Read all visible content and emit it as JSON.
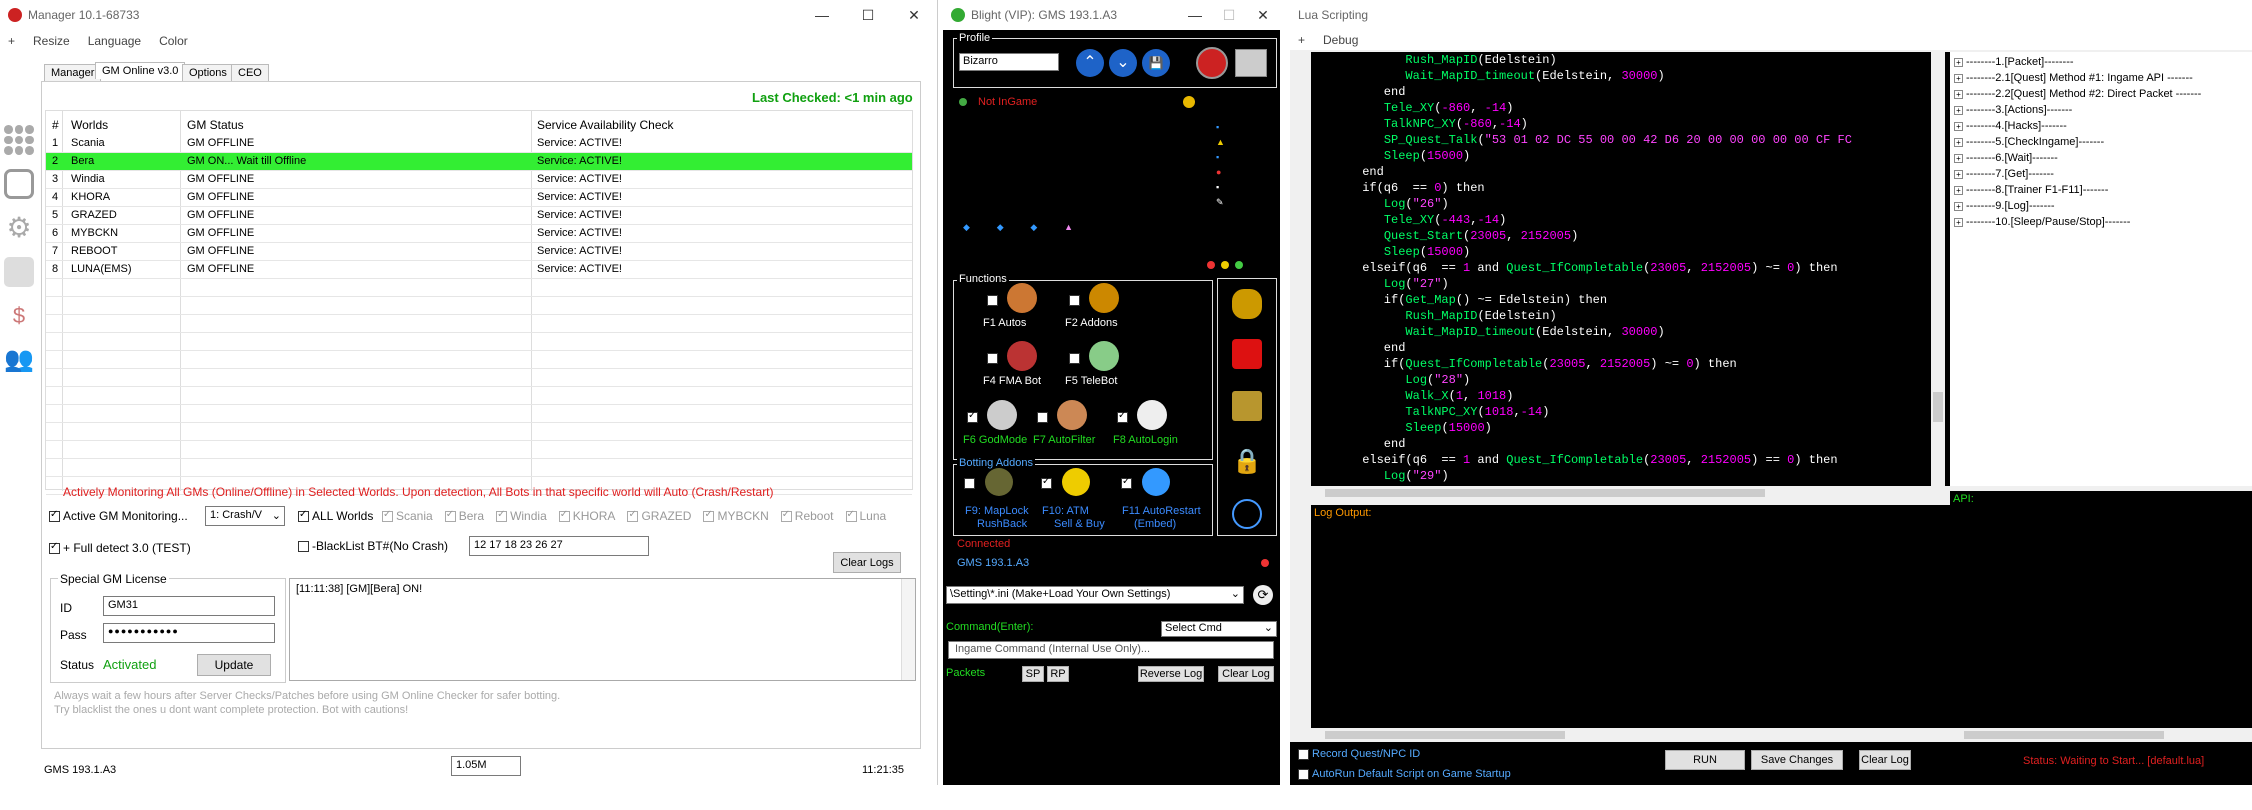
{
  "manager": {
    "title": "Manager 10.1-68733",
    "menu": [
      "+",
      "Resize",
      "Language",
      "Color"
    ],
    "tabs": [
      "Manager",
      "GM Online v3.0",
      "Options",
      "CEO"
    ],
    "last_checked": "Last Checked: <1 min ago",
    "table": {
      "headers": [
        "#",
        "Worlds",
        "GM Status",
        "Service Availability Check"
      ],
      "rows": [
        [
          "1",
          "Scania",
          "GM OFFLINE",
          "Service: ACTIVE!"
        ],
        [
          "2",
          "Bera",
          "GM ON... Wait till Offline",
          "Service: ACTIVE!"
        ],
        [
          "3",
          "Windia",
          "GM OFFLINE",
          "Service: ACTIVE!"
        ],
        [
          "4",
          "KHORA",
          "GM OFFLINE",
          "Service: ACTIVE!"
        ],
        [
          "5",
          "GRAZED",
          "GM OFFLINE",
          "Service: ACTIVE!"
        ],
        [
          "6",
          "MYBCKN",
          "GM OFFLINE",
          "Service: ACTIVE!"
        ],
        [
          "7",
          "REBOOT",
          "GM OFFLINE",
          "Service: ACTIVE!"
        ],
        [
          "8",
          "LUNA(EMS)",
          "GM OFFLINE",
          "Service: ACTIVE!"
        ]
      ]
    },
    "monitor_notice": "Actively Monitoring All GMs (Online/Offline) in Selected Worlds. Upon detection, All Bots in that specific world will Auto (Crash/Restart)",
    "active_gm_monitoring": "Active GM Monitoring...",
    "crash_select": "1: Crash/V",
    "all_worlds": "ALL Worlds",
    "worlds_checks": [
      "Scania",
      "Bera",
      "Windia",
      "KHORA",
      "GRAZED",
      "MYBCKN",
      "Reboot",
      "Luna"
    ],
    "full_detect": "+ Full detect 3.0 (TEST)",
    "blacklist_label": "-BlackList BT#(No Crash)",
    "blacklist_value": "12 17 18 23 26 27",
    "clear_logs": "Clear Logs",
    "license_title": "Special GM License",
    "id_label": "ID",
    "id_value": "GM31",
    "pass_label": "Pass",
    "pass_value": "●●●●●●●●●●●",
    "status_label": "Status",
    "status_value": "Activated",
    "update_btn": "Update",
    "log_text": "[11:11:38] [GM][Bera] ON!",
    "footer_note_1": "Always wait a few hours after Server Checks/Patches before using GM Online Checker for safer botting.",
    "footer_note_2": "Try blacklist the ones u dont want complete protection. Bot with cautions!",
    "status_bar_left": "GMS 193.1.A3",
    "status_bar_mid": "1.05M",
    "status_bar_time": "11:21:35"
  },
  "blight": {
    "title": "Blight (VIP): GMS 193.1.A3",
    "profile_label": "Profile",
    "profile_value": "Bizarro",
    "not_ingame": "Not InGame",
    "functions_label": "Functions",
    "functions": [
      {
        "key": "F1",
        "name": "Autos"
      },
      {
        "key": "F2",
        "name": "Addons"
      },
      {
        "key": "F4",
        "name": "FMA Bot"
      },
      {
        "key": "F5",
        "name": "TeleBot"
      },
      {
        "key": "F6",
        "name": "GodMode"
      },
      {
        "key": "F7",
        "name": "AutoFilter"
      },
      {
        "key": "F8",
        "name": "AutoLogin"
      }
    ],
    "botting_label": "Botting Addons",
    "botting": [
      {
        "line1": "F9: MapLock",
        "line2": "RushBack"
      },
      {
        "line1": "F10: ATM",
        "line2": "Sell & Buy"
      },
      {
        "line1": "F11 AutoRestart",
        "line2": "(Embed)"
      }
    ],
    "connected": "Connected",
    "version": "GMS 193.1.A3",
    "settings_select": "\\Setting\\*.ini (Make+Load Your Own Settings)",
    "command_label": "Command(Enter):",
    "select_cmd": "Select Cmd",
    "ingame_cmd_placeholder": "Ingame Command (Internal Use Only)...",
    "packets_label": "Packets",
    "sp": "SP",
    "rp": "RP",
    "reverse_log": "Reverse Log",
    "clear_log": "Clear Log"
  },
  "lua": {
    "title": "Lua Scripting",
    "menu": [
      "+",
      "Debug"
    ],
    "code_lines": [
      [
        {
          "t": "            ",
          "c": "txt"
        },
        {
          "t": "Rush_MapID",
          "c": "fn"
        },
        {
          "t": "(Edelstein)",
          "c": "kw"
        }
      ],
      [
        {
          "t": "            ",
          "c": "txt"
        },
        {
          "t": "Wait_MapID_timeout",
          "c": "fn"
        },
        {
          "t": "(Edelstein, ",
          "c": "kw"
        },
        {
          "t": "30000",
          "c": "num"
        },
        {
          "t": ")",
          "c": "kw"
        }
      ],
      [
        {
          "t": "         end",
          "c": "kw"
        }
      ],
      [
        {
          "t": "         ",
          "c": "txt"
        },
        {
          "t": "Tele_XY",
          "c": "fn"
        },
        {
          "t": "(",
          "c": "kw"
        },
        {
          "t": "-860",
          "c": "num"
        },
        {
          "t": ", ",
          "c": "kw"
        },
        {
          "t": "-14",
          "c": "num"
        },
        {
          "t": ")",
          "c": "kw"
        }
      ],
      [
        {
          "t": "         ",
          "c": "txt"
        },
        {
          "t": "TalkNPC_XY",
          "c": "fn"
        },
        {
          "t": "(",
          "c": "kw"
        },
        {
          "t": "-860",
          "c": "num"
        },
        {
          "t": ",",
          "c": "kw"
        },
        {
          "t": "-14",
          "c": "num"
        },
        {
          "t": ")",
          "c": "kw"
        }
      ],
      [
        {
          "t": "         ",
          "c": "txt"
        },
        {
          "t": "SP_Quest_Talk",
          "c": "fn"
        },
        {
          "t": "(",
          "c": "kw"
        },
        {
          "t": "\"53 01 02 DC 55 00 00 42 D6 20 00 00 00 00 00 CF FC",
          "c": "str"
        }
      ],
      [
        {
          "t": "         ",
          "c": "txt"
        },
        {
          "t": "Sleep",
          "c": "fn"
        },
        {
          "t": "(",
          "c": "kw"
        },
        {
          "t": "15000",
          "c": "num"
        },
        {
          "t": ")",
          "c": "kw"
        }
      ],
      [
        {
          "t": "      end",
          "c": "kw"
        }
      ],
      [
        {
          "t": "      if",
          "c": "kw"
        },
        {
          "t": "(q6  == ",
          "c": "kw"
        },
        {
          "t": "0",
          "c": "num"
        },
        {
          "t": ") then",
          "c": "kw"
        }
      ],
      [
        {
          "t": "         ",
          "c": "txt"
        },
        {
          "t": "Log",
          "c": "fn"
        },
        {
          "t": "(",
          "c": "kw"
        },
        {
          "t": "\"26\"",
          "c": "str"
        },
        {
          "t": ")",
          "c": "kw"
        }
      ],
      [
        {
          "t": "         ",
          "c": "txt"
        },
        {
          "t": "Tele_XY",
          "c": "fn"
        },
        {
          "t": "(",
          "c": "kw"
        },
        {
          "t": "-443",
          "c": "num"
        },
        {
          "t": ",",
          "c": "kw"
        },
        {
          "t": "-14",
          "c": "num"
        },
        {
          "t": ")",
          "c": "kw"
        }
      ],
      [
        {
          "t": "         ",
          "c": "txt"
        },
        {
          "t": "Quest_Start",
          "c": "fn"
        },
        {
          "t": "(",
          "c": "kw"
        },
        {
          "t": "23005",
          "c": "num"
        },
        {
          "t": ", ",
          "c": "kw"
        },
        {
          "t": "2152005",
          "c": "num"
        },
        {
          "t": ")",
          "c": "kw"
        }
      ],
      [
        {
          "t": "         ",
          "c": "txt"
        },
        {
          "t": "Sleep",
          "c": "fn"
        },
        {
          "t": "(",
          "c": "kw"
        },
        {
          "t": "15000",
          "c": "num"
        },
        {
          "t": ")",
          "c": "kw"
        }
      ],
      [
        {
          "t": "      elseif",
          "c": "kw"
        },
        {
          "t": "(q6  == ",
          "c": "kw"
        },
        {
          "t": "1",
          "c": "num"
        },
        {
          "t": " and ",
          "c": "kw"
        },
        {
          "t": "Quest_IfCompletable",
          "c": "fn"
        },
        {
          "t": "(",
          "c": "kw"
        },
        {
          "t": "23005",
          "c": "num"
        },
        {
          "t": ", ",
          "c": "kw"
        },
        {
          "t": "2152005",
          "c": "num"
        },
        {
          "t": ") ~= ",
          "c": "kw"
        },
        {
          "t": "0",
          "c": "num"
        },
        {
          "t": ") then",
          "c": "kw"
        }
      ],
      [
        {
          "t": "         ",
          "c": "txt"
        },
        {
          "t": "Log",
          "c": "fn"
        },
        {
          "t": "(",
          "c": "kw"
        },
        {
          "t": "\"27\"",
          "c": "str"
        },
        {
          "t": ")",
          "c": "kw"
        }
      ],
      [
        {
          "t": "         if",
          "c": "kw"
        },
        {
          "t": "(",
          "c": "kw"
        },
        {
          "t": "Get_Map",
          "c": "fn"
        },
        {
          "t": "() ~= Edelstein) then",
          "c": "kw"
        }
      ],
      [
        {
          "t": "            ",
          "c": "txt"
        },
        {
          "t": "Rush_MapID",
          "c": "fn"
        },
        {
          "t": "(Edelstein)",
          "c": "kw"
        }
      ],
      [
        {
          "t": "            ",
          "c": "txt"
        },
        {
          "t": "Wait_MapID_timeout",
          "c": "fn"
        },
        {
          "t": "(Edelstein, ",
          "c": "kw"
        },
        {
          "t": "30000",
          "c": "num"
        },
        {
          "t": ")",
          "c": "kw"
        }
      ],
      [
        {
          "t": "         end",
          "c": "kw"
        }
      ],
      [
        {
          "t": "         if",
          "c": "kw"
        },
        {
          "t": "(",
          "c": "kw"
        },
        {
          "t": "Quest_IfCompletable",
          "c": "fn"
        },
        {
          "t": "(",
          "c": "kw"
        },
        {
          "t": "23005",
          "c": "num"
        },
        {
          "t": ", ",
          "c": "kw"
        },
        {
          "t": "2152005",
          "c": "num"
        },
        {
          "t": ") ~= ",
          "c": "kw"
        },
        {
          "t": "0",
          "c": "num"
        },
        {
          "t": ") then",
          "c": "kw"
        }
      ],
      [
        {
          "t": "            ",
          "c": "txt"
        },
        {
          "t": "Log",
          "c": "fn"
        },
        {
          "t": "(",
          "c": "kw"
        },
        {
          "t": "\"28\"",
          "c": "str"
        },
        {
          "t": ")",
          "c": "kw"
        }
      ],
      [
        {
          "t": "            ",
          "c": "txt"
        },
        {
          "t": "Walk_X",
          "c": "fn"
        },
        {
          "t": "(",
          "c": "kw"
        },
        {
          "t": "1",
          "c": "num"
        },
        {
          "t": ", ",
          "c": "kw"
        },
        {
          "t": "1018",
          "c": "num"
        },
        {
          "t": ")",
          "c": "kw"
        }
      ],
      [
        {
          "t": "            ",
          "c": "txt"
        },
        {
          "t": "TalkNPC_XY",
          "c": "fn"
        },
        {
          "t": "(",
          "c": "kw"
        },
        {
          "t": "1018",
          "c": "num"
        },
        {
          "t": ",",
          "c": "kw"
        },
        {
          "t": "-14",
          "c": "num"
        },
        {
          "t": ")",
          "c": "kw"
        }
      ],
      [
        {
          "t": "            ",
          "c": "txt"
        },
        {
          "t": "Sleep",
          "c": "fn"
        },
        {
          "t": "(",
          "c": "kw"
        },
        {
          "t": "15000",
          "c": "num"
        },
        {
          "t": ")",
          "c": "kw"
        }
      ],
      [
        {
          "t": "         end",
          "c": "kw"
        }
      ],
      [
        {
          "t": "      elseif",
          "c": "kw"
        },
        {
          "t": "(q6  == ",
          "c": "kw"
        },
        {
          "t": "1",
          "c": "num"
        },
        {
          "t": " and ",
          "c": "kw"
        },
        {
          "t": "Quest_IfCompletable",
          "c": "fn"
        },
        {
          "t": "(",
          "c": "kw"
        },
        {
          "t": "23005",
          "c": "num"
        },
        {
          "t": ", ",
          "c": "kw"
        },
        {
          "t": "2152005",
          "c": "num"
        },
        {
          "t": ") == ",
          "c": "kw"
        },
        {
          "t": "0",
          "c": "num"
        },
        {
          "t": ") then",
          "c": "kw"
        }
      ],
      [
        {
          "t": "         ",
          "c": "txt"
        },
        {
          "t": "Log",
          "c": "fn"
        },
        {
          "t": "(",
          "c": "kw"
        },
        {
          "t": "\"29\"",
          "c": "str"
        },
        {
          "t": ")",
          "c": "kw"
        }
      ]
    ],
    "tree": [
      "--------1.[Packet]--------",
      "--------2.1[Quest] Method #1: Ingame API -------",
      "--------2.2[Quest] Method #2: Direct Packet -------",
      "--------3.[Actions]-------",
      "--------4.[Hacks]-------",
      "--------5.[CheckIngame]-------",
      "--------6.[Wait]-------",
      "--------7.[Get]-------",
      "--------8.[Trainer F1-F11]-------",
      "--------9.[Log]-------",
      "--------10.[Sleep/Pause/Stop]-------"
    ],
    "log_output_label": "Log Output:",
    "api_label": "API:",
    "record_quest": "Record Quest/NPC ID",
    "autorun": "AutoRun Default Script on Game Startup",
    "run_btn": "RUN",
    "save_btn": "Save Changes",
    "clear_log_btn": "Clear Log",
    "status_text": "Status: Waiting to Start... [default.lua]"
  },
  "colors": {
    "highlight_row": "#33ee33",
    "red_text": "#e02020",
    "green_text": "#10a010"
  }
}
